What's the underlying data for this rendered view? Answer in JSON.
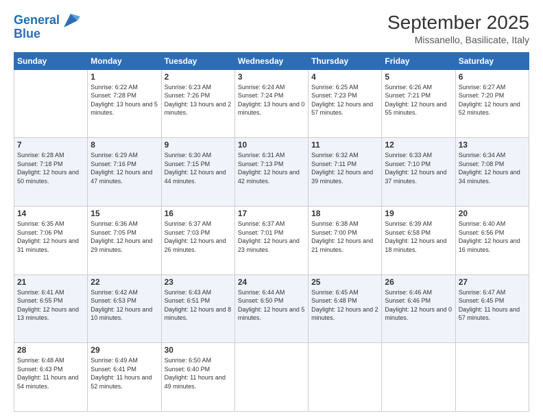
{
  "logo": {
    "line1": "General",
    "line2": "Blue"
  },
  "title": "September 2025",
  "subtitle": "Missanello, Basilicate, Italy",
  "days_header": [
    "Sunday",
    "Monday",
    "Tuesday",
    "Wednesday",
    "Thursday",
    "Friday",
    "Saturday"
  ],
  "weeks": [
    [
      {
        "day": "",
        "sunrise": "",
        "sunset": "",
        "daylight": ""
      },
      {
        "day": "1",
        "sunrise": "Sunrise: 6:22 AM",
        "sunset": "Sunset: 7:28 PM",
        "daylight": "Daylight: 13 hours and 5 minutes."
      },
      {
        "day": "2",
        "sunrise": "Sunrise: 6:23 AM",
        "sunset": "Sunset: 7:26 PM",
        "daylight": "Daylight: 13 hours and 2 minutes."
      },
      {
        "day": "3",
        "sunrise": "Sunrise: 6:24 AM",
        "sunset": "Sunset: 7:24 PM",
        "daylight": "Daylight: 13 hours and 0 minutes."
      },
      {
        "day": "4",
        "sunrise": "Sunrise: 6:25 AM",
        "sunset": "Sunset: 7:23 PM",
        "daylight": "Daylight: 12 hours and 57 minutes."
      },
      {
        "day": "5",
        "sunrise": "Sunrise: 6:26 AM",
        "sunset": "Sunset: 7:21 PM",
        "daylight": "Daylight: 12 hours and 55 minutes."
      },
      {
        "day": "6",
        "sunrise": "Sunrise: 6:27 AM",
        "sunset": "Sunset: 7:20 PM",
        "daylight": "Daylight: 12 hours and 52 minutes."
      }
    ],
    [
      {
        "day": "7",
        "sunrise": "Sunrise: 6:28 AM",
        "sunset": "Sunset: 7:18 PM",
        "daylight": "Daylight: 12 hours and 50 minutes."
      },
      {
        "day": "8",
        "sunrise": "Sunrise: 6:29 AM",
        "sunset": "Sunset: 7:16 PM",
        "daylight": "Daylight: 12 hours and 47 minutes."
      },
      {
        "day": "9",
        "sunrise": "Sunrise: 6:30 AM",
        "sunset": "Sunset: 7:15 PM",
        "daylight": "Daylight: 12 hours and 44 minutes."
      },
      {
        "day": "10",
        "sunrise": "Sunrise: 6:31 AM",
        "sunset": "Sunset: 7:13 PM",
        "daylight": "Daylight: 12 hours and 42 minutes."
      },
      {
        "day": "11",
        "sunrise": "Sunrise: 6:32 AM",
        "sunset": "Sunset: 7:11 PM",
        "daylight": "Daylight: 12 hours and 39 minutes."
      },
      {
        "day": "12",
        "sunrise": "Sunrise: 6:33 AM",
        "sunset": "Sunset: 7:10 PM",
        "daylight": "Daylight: 12 hours and 37 minutes."
      },
      {
        "day": "13",
        "sunrise": "Sunrise: 6:34 AM",
        "sunset": "Sunset: 7:08 PM",
        "daylight": "Daylight: 12 hours and 34 minutes."
      }
    ],
    [
      {
        "day": "14",
        "sunrise": "Sunrise: 6:35 AM",
        "sunset": "Sunset: 7:06 PM",
        "daylight": "Daylight: 12 hours and 31 minutes."
      },
      {
        "day": "15",
        "sunrise": "Sunrise: 6:36 AM",
        "sunset": "Sunset: 7:05 PM",
        "daylight": "Daylight: 12 hours and 29 minutes."
      },
      {
        "day": "16",
        "sunrise": "Sunrise: 6:37 AM",
        "sunset": "Sunset: 7:03 PM",
        "daylight": "Daylight: 12 hours and 26 minutes."
      },
      {
        "day": "17",
        "sunrise": "Sunrise: 6:37 AM",
        "sunset": "Sunset: 7:01 PM",
        "daylight": "Daylight: 12 hours and 23 minutes."
      },
      {
        "day": "18",
        "sunrise": "Sunrise: 6:38 AM",
        "sunset": "Sunset: 7:00 PM",
        "daylight": "Daylight: 12 hours and 21 minutes."
      },
      {
        "day": "19",
        "sunrise": "Sunrise: 6:39 AM",
        "sunset": "Sunset: 6:58 PM",
        "daylight": "Daylight: 12 hours and 18 minutes."
      },
      {
        "day": "20",
        "sunrise": "Sunrise: 6:40 AM",
        "sunset": "Sunset: 6:56 PM",
        "daylight": "Daylight: 12 hours and 16 minutes."
      }
    ],
    [
      {
        "day": "21",
        "sunrise": "Sunrise: 6:41 AM",
        "sunset": "Sunset: 6:55 PM",
        "daylight": "Daylight: 12 hours and 13 minutes."
      },
      {
        "day": "22",
        "sunrise": "Sunrise: 6:42 AM",
        "sunset": "Sunset: 6:53 PM",
        "daylight": "Daylight: 12 hours and 10 minutes."
      },
      {
        "day": "23",
        "sunrise": "Sunrise: 6:43 AM",
        "sunset": "Sunset: 6:51 PM",
        "daylight": "Daylight: 12 hours and 8 minutes."
      },
      {
        "day": "24",
        "sunrise": "Sunrise: 6:44 AM",
        "sunset": "Sunset: 6:50 PM",
        "daylight": "Daylight: 12 hours and 5 minutes."
      },
      {
        "day": "25",
        "sunrise": "Sunrise: 6:45 AM",
        "sunset": "Sunset: 6:48 PM",
        "daylight": "Daylight: 12 hours and 2 minutes."
      },
      {
        "day": "26",
        "sunrise": "Sunrise: 6:46 AM",
        "sunset": "Sunset: 6:46 PM",
        "daylight": "Daylight: 12 hours and 0 minutes."
      },
      {
        "day": "27",
        "sunrise": "Sunrise: 6:47 AM",
        "sunset": "Sunset: 6:45 PM",
        "daylight": "Daylight: 11 hours and 57 minutes."
      }
    ],
    [
      {
        "day": "28",
        "sunrise": "Sunrise: 6:48 AM",
        "sunset": "Sunset: 6:43 PM",
        "daylight": "Daylight: 11 hours and 54 minutes."
      },
      {
        "day": "29",
        "sunrise": "Sunrise: 6:49 AM",
        "sunset": "Sunset: 6:41 PM",
        "daylight": "Daylight: 11 hours and 52 minutes."
      },
      {
        "day": "30",
        "sunrise": "Sunrise: 6:50 AM",
        "sunset": "Sunset: 6:40 PM",
        "daylight": "Daylight: 11 hours and 49 minutes."
      },
      {
        "day": "",
        "sunrise": "",
        "sunset": "",
        "daylight": ""
      },
      {
        "day": "",
        "sunrise": "",
        "sunset": "",
        "daylight": ""
      },
      {
        "day": "",
        "sunrise": "",
        "sunset": "",
        "daylight": ""
      },
      {
        "day": "",
        "sunrise": "",
        "sunset": "",
        "daylight": ""
      }
    ]
  ]
}
